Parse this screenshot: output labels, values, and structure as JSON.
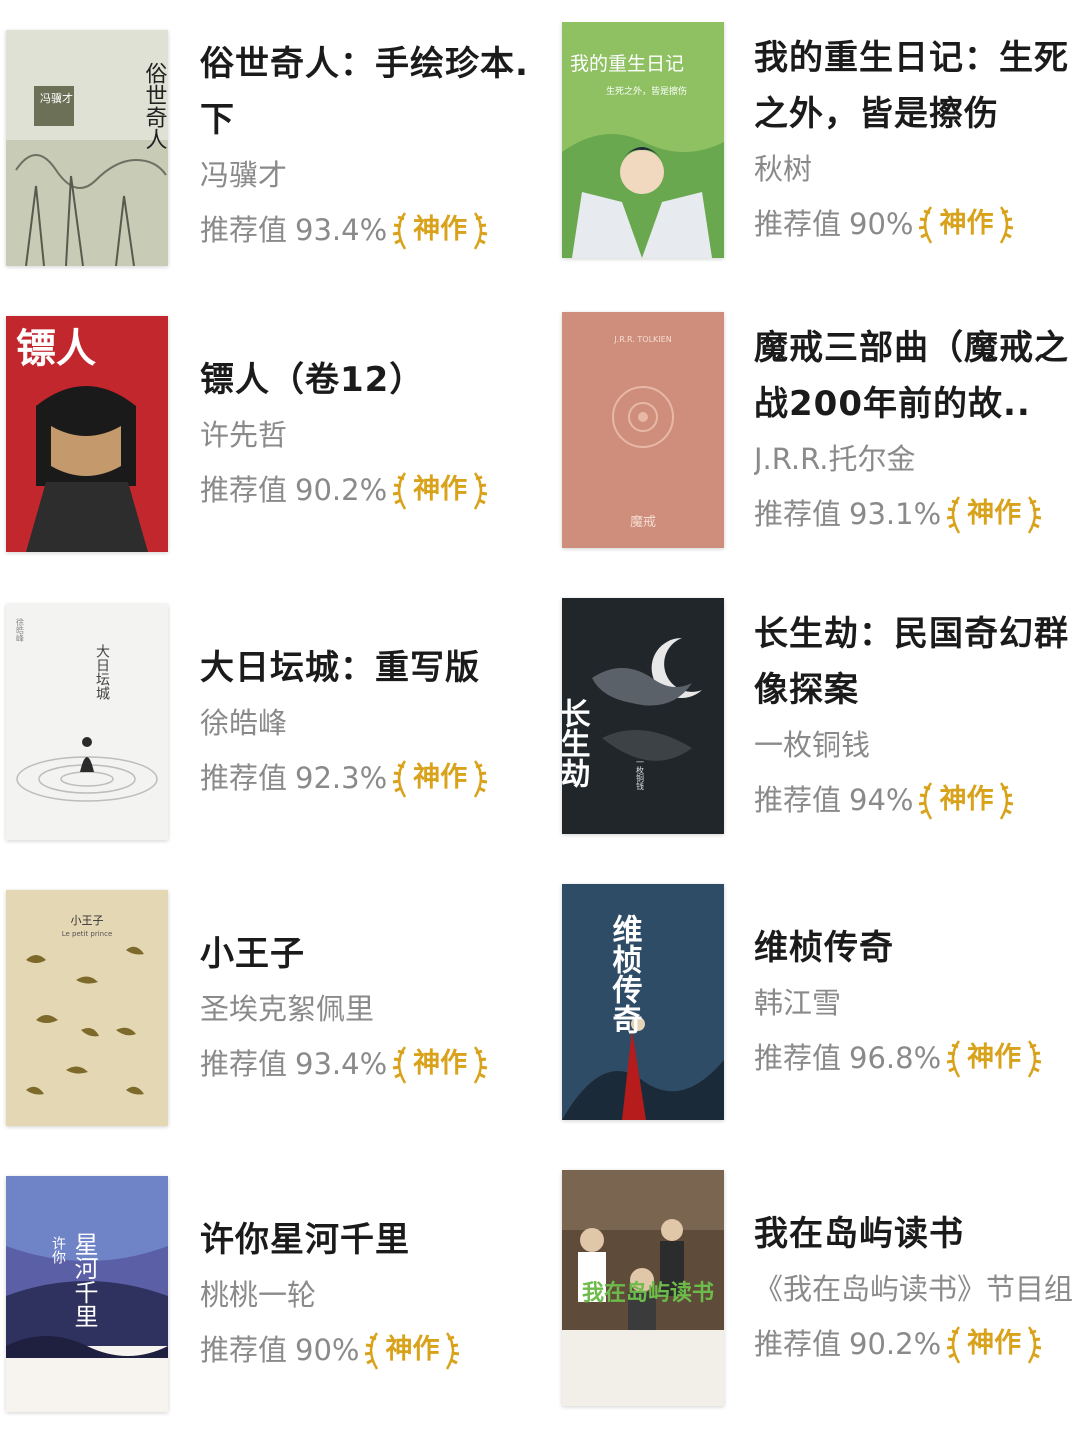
{
  "books": [
    {
      "title": "俗世奇人：手绘珍本.下",
      "author": "冯骥才",
      "rec_label": "推荐值",
      "rec_value": "93.4%",
      "badge": "神作",
      "cover_text": "俗世奇人",
      "cover_sub": "冯骥才"
    },
    {
      "title": "我的重生日记：生死之外，皆是擦伤",
      "author": "秋树",
      "rec_label": "推荐值",
      "rec_value": "90%",
      "badge": "神作",
      "cover_text": "我的重生日记",
      "cover_sub": "生死之外，皆是擦伤"
    },
    {
      "title": "镖人（卷12）",
      "author": "许先哲",
      "rec_label": "推荐值",
      "rec_value": "90.2%",
      "badge": "神作",
      "cover_text": "镖人"
    },
    {
      "title": "魔戒三部曲（魔戒之战200年前的故..",
      "author": "J.R.R.托尔金",
      "rec_label": "推荐值",
      "rec_value": "93.1%",
      "badge": "神作",
      "cover_text": "魔戒",
      "cover_sub": "J.R.R. TOLKIEN"
    },
    {
      "title": "大日坛城：重写版",
      "author": "徐皓峰",
      "rec_label": "推荐值",
      "rec_value": "92.3%",
      "badge": "神作",
      "cover_text": "大日坛城",
      "cover_sub": "徐皓峰"
    },
    {
      "title": "长生劫：民国奇幻群像探案",
      "author": "一枚铜钱",
      "rec_label": "推荐值",
      "rec_value": "94%",
      "badge": "神作",
      "cover_text": "长生劫",
      "cover_sub": "一枚铜钱"
    },
    {
      "title": "小王子",
      "author": "圣埃克絮佩里",
      "rec_label": "推荐值",
      "rec_value": "93.4%",
      "badge": "神作",
      "cover_text": "小王子",
      "cover_sub": "Le petit prince"
    },
    {
      "title": "维桢传奇",
      "author": "韩江雪",
      "rec_label": "推荐值",
      "rec_value": "96.8%",
      "badge": "神作",
      "cover_text": "维桢传奇"
    },
    {
      "title": "许你星河千里",
      "author": "桃桃一轮",
      "rec_label": "推荐值",
      "rec_value": "90%",
      "badge": "神作",
      "cover_text": "星河千里",
      "cover_sub": "许你"
    },
    {
      "title": "我在岛屿读书",
      "author": "《我在岛屿读书》节目组",
      "rec_label": "推荐值",
      "rec_value": "90.2%",
      "badge": "神作",
      "cover_text": "我在岛屿读书"
    }
  ],
  "colors": {
    "badge_gold": "#d9a21b",
    "title": "#1b1b1b",
    "meta": "#8a8a8a"
  }
}
